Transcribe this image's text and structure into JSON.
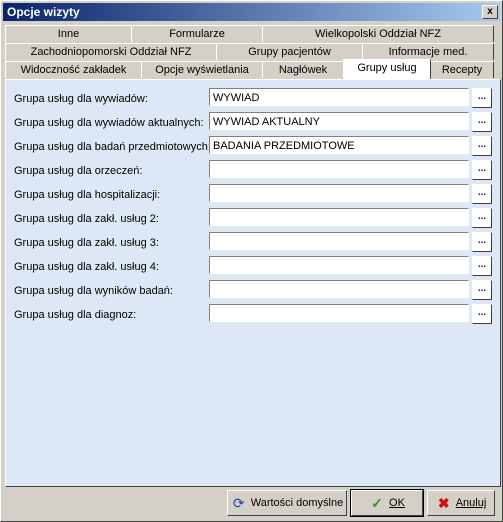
{
  "window": {
    "title": "Opcje wizyty",
    "close_label": "x"
  },
  "tabs": {
    "row1": [
      "Inne",
      "Formularze",
      "Wielkopolski Oddział NFZ"
    ],
    "row2": [
      "Zachodniopomorski Oddział NFZ",
      "Grupy pacjentów",
      "Informacje med."
    ],
    "row3": [
      "Widoczność zakładek",
      "Opcje wyświetlania",
      "Nagłówek",
      "Grupy usług",
      "Recepty"
    ],
    "active": "Grupy usług"
  },
  "form": {
    "rows": [
      {
        "label": "Grupa usług dla wywiadów:",
        "value": "WYWIAD",
        "button": "..."
      },
      {
        "label": "Grupa usług dla wywiadów aktualnych:",
        "value": "WYWIAD AKTUALNY",
        "button": "..."
      },
      {
        "label": "Grupa usług dla badań przedmiotowych:",
        "value": "BADANIA PRZEDMIOTOWE",
        "button": "..."
      },
      {
        "label": "Grupa usług dla orzeczeń:",
        "value": "",
        "button": "..."
      },
      {
        "label": "Grupa usług dla hospitalizacji:",
        "value": "",
        "button": "..."
      },
      {
        "label": "Grupa usług dla zakł. usług 2:",
        "value": "",
        "button": "..."
      },
      {
        "label": "Grupa usług dla zakł. usług 3:",
        "value": "",
        "button": "..."
      },
      {
        "label": "Grupa usług dla zakł. usług 4:",
        "value": "",
        "button": "..."
      },
      {
        "label": "Grupa usług dla wyników badań:",
        "value": "",
        "button": "..."
      },
      {
        "label": "Grupa usług dla diagnoz:",
        "value": "",
        "button": "..."
      }
    ]
  },
  "footer": {
    "defaults_label": "Wartości domyślne",
    "ok_label": "OK",
    "cancel_label": "Anuluj"
  },
  "colors": {
    "titlebar": "#0a246a",
    "panel": "#dce8f6",
    "ok_icon": "#2a9a2a",
    "cancel_icon": "#d01010",
    "refresh_icon": "#1a4aa8"
  },
  "icons": {
    "defaults": "refresh-icon",
    "ok": "checkmark-icon",
    "cancel": "x-icon"
  }
}
